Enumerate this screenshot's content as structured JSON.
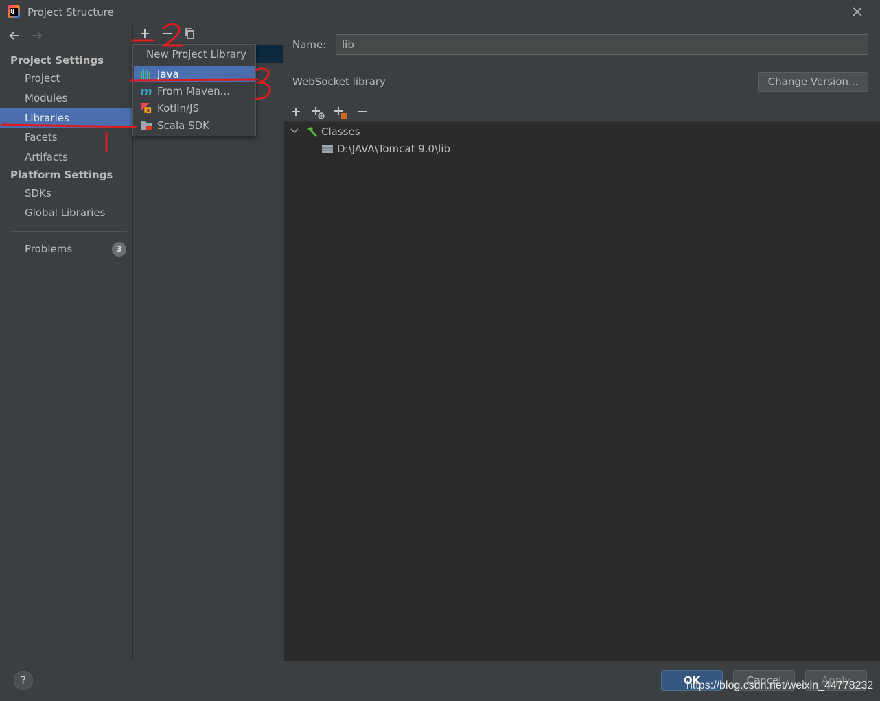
{
  "window": {
    "title": "Project Structure",
    "close_icon": "close-icon"
  },
  "colors": {
    "background": "#3c3f41",
    "selection": "#4b6eaf",
    "tree_background": "#2b2b2b",
    "annotation": "#e01b1b",
    "ok_button": "#365880"
  },
  "sidebar": {
    "project_settings_title": "Project Settings",
    "project_settings_items": [
      "Project",
      "Modules",
      "Libraries",
      "Facets",
      "Artifacts"
    ],
    "selected_item": "Libraries",
    "platform_settings_title": "Platform Settings",
    "platform_settings_items": [
      "SDKs",
      "Global Libraries"
    ],
    "problems_label": "Problems",
    "problems_count": "3"
  },
  "popup": {
    "title": "New Project Library",
    "items": [
      {
        "label": "Java",
        "icon": "java-library-icon",
        "selected": true
      },
      {
        "label": "From Maven...",
        "icon": "maven-icon",
        "selected": false
      },
      {
        "label": "Kotlin/JS",
        "icon": "kotlin-js-icon",
        "selected": false
      },
      {
        "label": "Scala SDK",
        "icon": "scala-sdk-icon",
        "selected": false
      }
    ]
  },
  "details": {
    "name_label": "Name:",
    "name_value": "lib",
    "library_type": "WebSocket library",
    "change_version_label": "Change Version...",
    "tree": {
      "root_label": "Classes",
      "children": [
        "D:\\JAVA\\Tomcat 9.0\\lib"
      ]
    }
  },
  "footer": {
    "help_label": "?",
    "ok_label": "OK",
    "cancel_label": "Cancel",
    "apply_label": "Apply"
  },
  "watermark": "https://blog.csdn.net/weixin_44778232",
  "annotations": [
    "1",
    "2",
    "3"
  ]
}
